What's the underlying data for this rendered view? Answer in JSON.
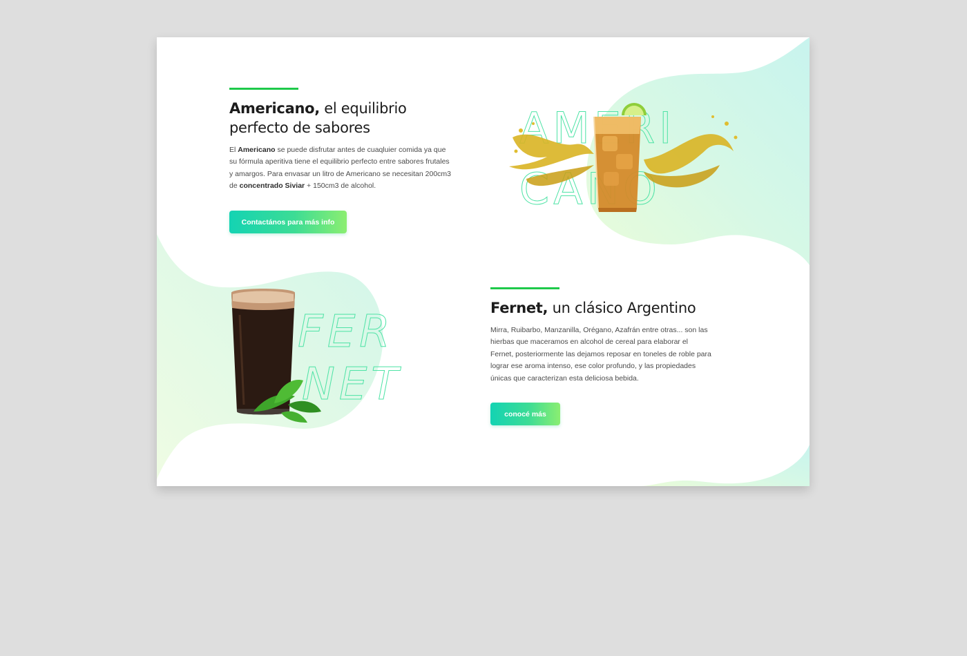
{
  "colors": {
    "page_bg": "#dedede",
    "card_bg": "#ffffff",
    "accent_line": "#1ec94a",
    "gradient_start": "#14d3b3",
    "gradient_end": "#8bee71",
    "outline_text": "#4fe3a6"
  },
  "americano": {
    "title_bold": "Americano,",
    "title_rest_line1": " el equilibrio",
    "title_line2": "perfecto de sabores",
    "body_1": "El ",
    "body_bold_1": "Americano",
    "body_2": " se puede disfrutar antes de cuaqluier comida ya que su fórmula aperitiva tiene el equilibrio perfecto entre sabores frutales y amargos. Para envasar un litro de Americano se necesitan 200cm3 de ",
    "body_bold_2": "concentrado Siviar",
    "body_3": " + 150cm3 de alcohol.",
    "button_label": "Contactános para más info",
    "outline_line1": "AMERI",
    "outline_line2": "CANO",
    "image_icon": "cocktail-glass-splash"
  },
  "fernet": {
    "title_bold": "Fernet,",
    "title_rest": " un clásico Argentino",
    "body": "Mirra, Ruibarbo, Manzanilla, Orégano, Azafrán entre otras... son las hierbas que maceramos en alcohol de cereal para elaborar el Fernet, posteriormente las dejamos reposar en toneles de roble para lograr ese aroma intenso, ese color profundo, y las propiedades únicas que caracterizan esta deliciosa bebida.",
    "button_label": "conocé más",
    "outline_line1": "FER",
    "outline_line2": "NET",
    "image_icon": "fernet-glass-mint"
  }
}
